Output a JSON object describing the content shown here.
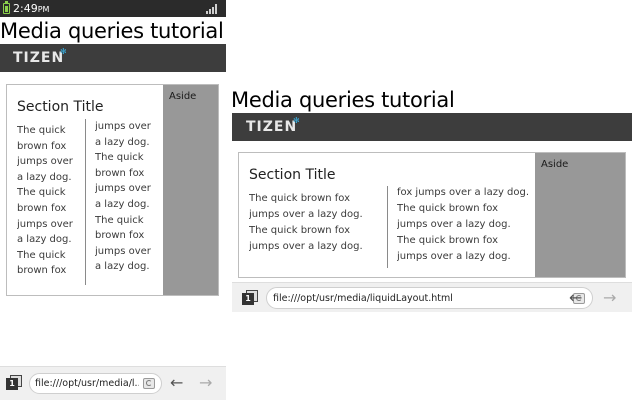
{
  "portrait": {
    "status": {
      "time": "2:49",
      "ampm": "PM"
    },
    "title": "Media queries tutorial",
    "logo": "TIZEN",
    "section_title": "Section Title",
    "col1_text": "The quick brown fox jumps over a lazy dog. The quick brown fox jumps over a lazy dog. The quick brown fox",
    "col2_text": "jumps over a lazy dog. The quick brown fox jumps over a lazy dog. The quick brown fox jumps over a lazy dog.",
    "aside": "Aside",
    "browser": {
      "tab_count": "1",
      "url": "file:///opt/usr/media/l..."
    }
  },
  "landscape": {
    "title": "Media queries tutorial",
    "logo": "TIZEN",
    "section_title": "Section Title",
    "col1_text": "The quick brown fox jumps over a lazy dog. The quick brown fox jumps over a lazy dog. The quick brown",
    "col2_text": "fox jumps over a lazy dog. The quick brown fox jumps over a lazy dog. The quick brown fox jumps over a lazy dog.",
    "aside": "Aside",
    "browser": {
      "tab_count": "1",
      "url": "file:///opt/usr/media/liquidLayout.html"
    }
  },
  "icons": {
    "battery": "battery-icon",
    "signal": "signal-icon",
    "tabs": "tabs-icon",
    "reload": "reload-icon",
    "back": "back-arrow-icon",
    "forward": "forward-arrow-icon"
  },
  "colors": {
    "tizen_bar": "#3d3d3d",
    "aside": "#989898",
    "logo_accent": "#39b3e6",
    "battery": "#8bd14b"
  }
}
